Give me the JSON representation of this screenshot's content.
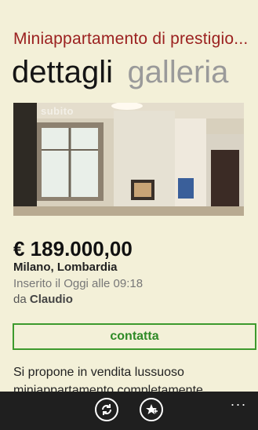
{
  "header": {
    "title": "Miniappartamento di prestigio...",
    "pivot": [
      "dettagli",
      "galleria"
    ]
  },
  "listing": {
    "watermark": "subito",
    "price": "€ 189.000,00",
    "location": "Milano, Lombardia",
    "inserted": "Inserito il Oggi alle 09:18",
    "by_prefix": "da",
    "author": "Claudio",
    "contact_label": "contatta",
    "description": "Si propone in vendita lussuoso miniappartamento completamente"
  },
  "appbar": {
    "buttons": [
      "sync-icon",
      "add-favorite-icon"
    ],
    "more": "..."
  },
  "colors": {
    "background": "#f3f0d8",
    "title": "#9b2120",
    "accent_green": "#3d9a2d",
    "appbar": "#1f1f1f"
  }
}
